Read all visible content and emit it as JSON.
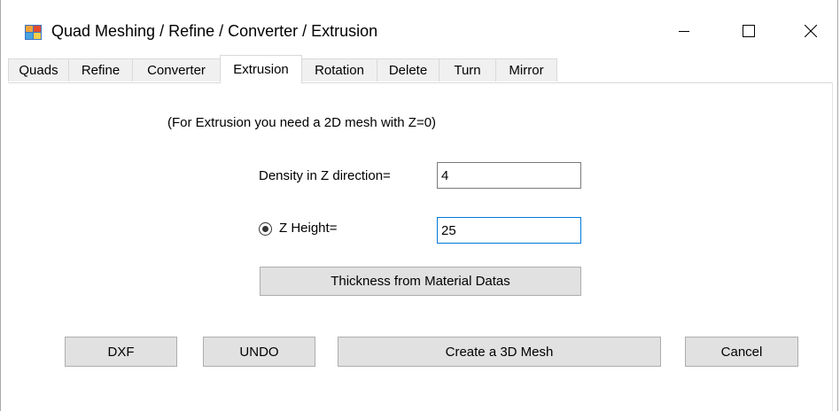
{
  "window": {
    "title": "Quad Meshing / Refine / Converter / Extrusion"
  },
  "tabs": [
    {
      "label": "Quads",
      "active": false
    },
    {
      "label": "Refine",
      "active": false
    },
    {
      "label": "Converter",
      "active": false
    },
    {
      "label": "Extrusion",
      "active": true
    },
    {
      "label": "Rotation",
      "active": false
    },
    {
      "label": "Delete",
      "active": false
    },
    {
      "label": "Turn",
      "active": false
    },
    {
      "label": "Mirror",
      "active": false
    }
  ],
  "extrusion": {
    "info_text": "(For Extrusion you need a 2D mesh with Z=0)",
    "density_label": "Density in Z direction=",
    "density_value": "4",
    "z_height_label": "Z Height=",
    "z_height_value": "25",
    "z_height_selected": true,
    "thickness_button": "Thickness from Material Datas"
  },
  "footer": {
    "dxf_button": "DXF",
    "undo_button": "UNDO",
    "create_button": "Create a 3D Mesh",
    "cancel_button": "Cancel"
  },
  "icons": {
    "app": "app-icon",
    "minimize": "minimize-icon",
    "maximize": "maximize-icon",
    "close": "close-icon"
  },
  "colors": {
    "focus_border": "#0078d7",
    "button_face": "#e1e1e1",
    "tab_face": "#f0f0f0"
  }
}
